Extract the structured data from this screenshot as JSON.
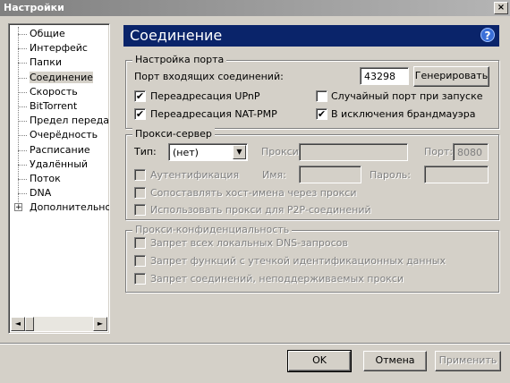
{
  "window": {
    "title": "Настройки",
    "close_glyph": "×"
  },
  "sidebar": {
    "items": [
      {
        "label": "Общие"
      },
      {
        "label": "Интерфейс"
      },
      {
        "label": "Папки"
      },
      {
        "label": "Соединение"
      },
      {
        "label": "Скорость"
      },
      {
        "label": "BitTorrent"
      },
      {
        "label": "Предел передачи"
      },
      {
        "label": "Очерёдность"
      },
      {
        "label": "Расписание"
      },
      {
        "label": "Удалённый"
      },
      {
        "label": "Поток"
      },
      {
        "label": "DNA"
      },
      {
        "label": "Дополнительно"
      }
    ],
    "selected": "Соединение",
    "expand_glyph": "+"
  },
  "panel": {
    "title": "Соединение",
    "help_glyph": "?"
  },
  "port_settings": {
    "legend": "Настройка порта",
    "port_label": "Порт входящих соединений:",
    "port_value": "43298",
    "generate_label": "Генерировать",
    "upnp_label": "Переадресация UPnP",
    "upnp_checked": true,
    "natpmp_label": "Переадресация NAT-PMP",
    "natpmp_checked": true,
    "random_port_label": "Случайный порт при запуске",
    "random_port_checked": false,
    "firewall_label": "В исключения брандмауэра",
    "firewall_checked": true
  },
  "proxy": {
    "legend": "Прокси-сервер",
    "type_label": "Тип:",
    "type_value": "(нет)",
    "proxy_label": "Прокси:",
    "proxy_value": "",
    "port_label": "Порт:",
    "port_value": "8080",
    "auth_label": "Аутентификация",
    "name_label": "Имя:",
    "password_label": "Пароль:",
    "resolve_label": "Сопоставлять хост-имена через прокси",
    "p2p_label": "Использовать прокси для P2P-соединений"
  },
  "privacy": {
    "legend": "Прокси-конфиденциальность",
    "dns_label": "Запрет всех локальных DNS-запросов",
    "leak_label": "Запрет функций с утечкой идентификационных данных",
    "unsupported_label": "Запрет соединений, неподдерживаемых прокси"
  },
  "footer": {
    "ok_label": "OK",
    "cancel_label": "Отмена",
    "apply_label": "Применить"
  },
  "colors": {
    "selection": "#0a246a",
    "face": "#d4d0c8"
  }
}
